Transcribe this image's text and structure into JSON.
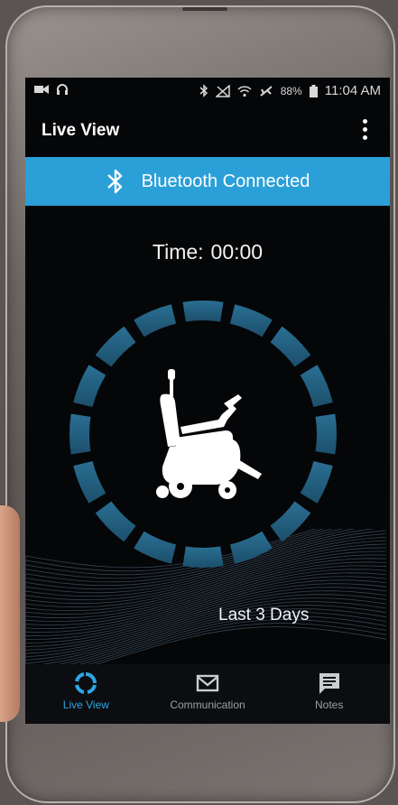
{
  "status_bar": {
    "battery": "88%",
    "time": "11:04 AM"
  },
  "app_bar": {
    "title": "Live View"
  },
  "banner": {
    "text": "Bluetooth Connected",
    "icon": "bluetooth-icon"
  },
  "timer": {
    "label": "Time:",
    "value": "00:00"
  },
  "ring": {
    "segments": 16,
    "icon": "power-wheelchair-icon"
  },
  "period_label": "Last 3 Days",
  "bottom_nav": {
    "items": [
      {
        "label": "Live View",
        "icon": "live-view-icon",
        "active": true
      },
      {
        "label": "Communication",
        "icon": "envelope-icon",
        "active": false
      },
      {
        "label": "Notes",
        "icon": "note-icon",
        "active": false
      }
    ]
  },
  "colors": {
    "accent": "#2ea6e3",
    "banner": "#2b9fd8",
    "screen_bg": "#050608"
  }
}
